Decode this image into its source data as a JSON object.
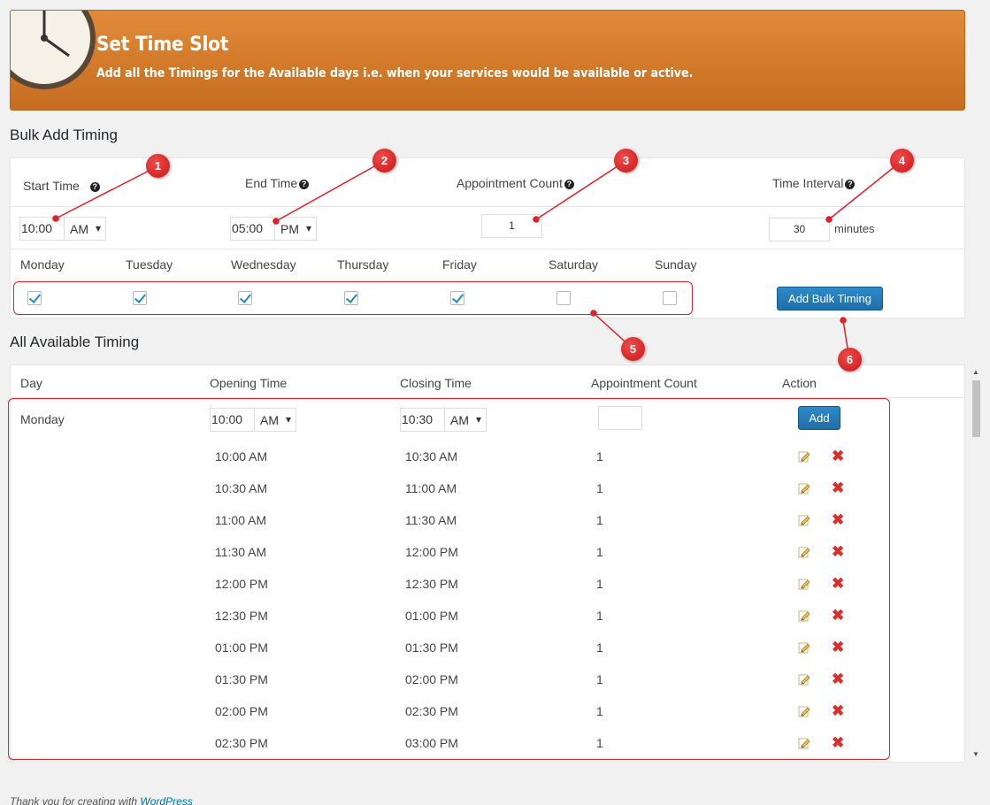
{
  "header": {
    "title": "Set Time Slot",
    "subtitle": "Add all the Timings for the Available days i.e. when your services would be available or active."
  },
  "bulk": {
    "heading": "Bulk Add Timing",
    "start_time_label": "Start Time",
    "end_time_label": "End Time",
    "appointment_count_label": "Appointment Count",
    "time_interval_label": "Time Interval",
    "help_glyph": "?",
    "start_time": {
      "value": "10:00",
      "ampm": "AM"
    },
    "end_time": {
      "value": "05:00",
      "ampm": "PM"
    },
    "appointment_count": "1",
    "interval": "30",
    "interval_unit": "minutes",
    "days": [
      {
        "label": "Monday",
        "checked": true
      },
      {
        "label": "Tuesday",
        "checked": true
      },
      {
        "label": "Wednesday",
        "checked": true
      },
      {
        "label": "Thursday",
        "checked": true
      },
      {
        "label": "Friday",
        "checked": true
      },
      {
        "label": "Saturday",
        "checked": false
      },
      {
        "label": "Sunday",
        "checked": false
      }
    ],
    "button_label": "Add Bulk Timing"
  },
  "available": {
    "heading": "All Available Timing",
    "columns": [
      "Day",
      "Opening Time",
      "Closing Time",
      "Appointment Count",
      "Action"
    ],
    "day": "Monday",
    "new_opening": {
      "value": "10:00",
      "ampm": "AM"
    },
    "new_closing": {
      "value": "10:30",
      "ampm": "AM"
    },
    "add_label": "Add",
    "rows": [
      {
        "open": "10:00 AM",
        "close": "10:30 AM",
        "count": "1"
      },
      {
        "open": "10:30 AM",
        "close": "11:00 AM",
        "count": "1"
      },
      {
        "open": "11:00 AM",
        "close": "11:30 AM",
        "count": "1"
      },
      {
        "open": "11:30 AM",
        "close": "12:00 PM",
        "count": "1"
      },
      {
        "open": "12:00 PM",
        "close": "12:30 PM",
        "count": "1"
      },
      {
        "open": "12:30 PM",
        "close": "01:00 PM",
        "count": "1"
      },
      {
        "open": "01:00 PM",
        "close": "01:30 PM",
        "count": "1"
      },
      {
        "open": "01:30 PM",
        "close": "02:00 PM",
        "count": "1"
      },
      {
        "open": "02:00 PM",
        "close": "02:30 PM",
        "count": "1"
      },
      {
        "open": "02:30 PM",
        "close": "03:00 PM",
        "count": "1"
      }
    ]
  },
  "annotations": [
    "1",
    "2",
    "3",
    "4",
    "5",
    "6"
  ],
  "footer": {
    "text": "Thank you for creating with ",
    "link": "WordPress"
  },
  "colors": {
    "banner": "#d27a2a",
    "accent": "#2271b1",
    "annotation": "#e0202a"
  },
  "icons": [
    "clock-icon",
    "help-icon",
    "pencil-icon",
    "delete-icon"
  ]
}
